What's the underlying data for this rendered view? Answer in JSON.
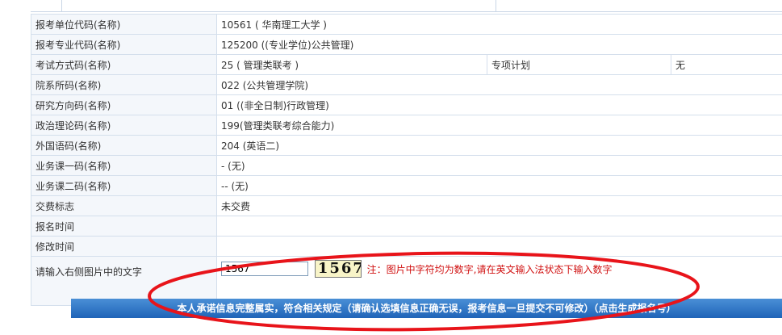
{
  "rows": [
    {
      "label": "报考单位代码(名称)",
      "value": "10561 ( 华南理工大学 )"
    },
    {
      "label": "报考专业代码(名称)",
      "value": "125200 ((专业学位)公共管理)"
    },
    {
      "label": "考试方式码(名称)",
      "value": "25 ( 管理类联考 )",
      "extra_label": "专项计划",
      "extra_value": "无"
    },
    {
      "label": "院系所码(名称)",
      "value": "022 (公共管理学院)"
    },
    {
      "label": "研究方向码(名称)",
      "value": "01 ((非全日制)行政管理)"
    },
    {
      "label": "政治理论码(名称)",
      "value": "199(管理类联考综合能力)"
    },
    {
      "label": "外国语码(名称)",
      "value": "204 (英语二)"
    },
    {
      "label": "业务课一码(名称)",
      "value": "- (无)"
    },
    {
      "label": "业务课二码(名称)",
      "value": "-- (无)"
    },
    {
      "label": "交费标志",
      "value": "未交费"
    },
    {
      "label": "报名时间",
      "value": ""
    },
    {
      "label": "修改时间",
      "value": ""
    }
  ],
  "captcha": {
    "label": "请输入右侧图片中的文字",
    "input_value": "1567",
    "image_text": "1567",
    "note": "注：图片中字符均为数字,请在英文输入法状态下输入数字"
  },
  "submit_label": "本人承诺信息完整属实，符合相关规定（请确认选填信息正确无误，报考信息一旦提交不可修改）（点击生成报名号）",
  "colors": {
    "annotation": "#e8141a",
    "button": "#1f64b8",
    "note": "#d01010"
  }
}
